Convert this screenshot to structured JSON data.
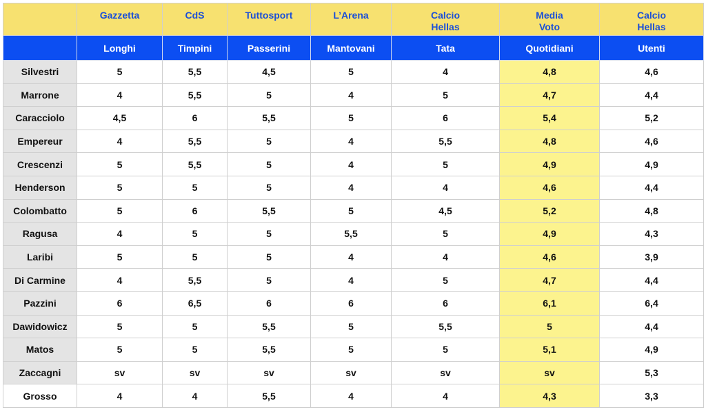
{
  "header_sources": [
    {
      "line1": "Gazzetta",
      "line2": ""
    },
    {
      "line1": "CdS",
      "line2": ""
    },
    {
      "line1": "Tuttosport",
      "line2": ""
    },
    {
      "line1": "L’Arena",
      "line2": ""
    },
    {
      "line1": "Calcio",
      "line2": "Hellas"
    },
    {
      "line1": "Media",
      "line2": "Voto"
    },
    {
      "line1": "Calcio",
      "line2": "Hellas"
    }
  ],
  "header_authors": [
    "Longhi",
    "Timpini",
    "Passerini",
    "Mantovani",
    "Tata",
    "Quotidiani",
    "Utenti"
  ],
  "rows": [
    {
      "player": "Silvestri",
      "ratings": [
        "5",
        "5,5",
        "4,5",
        "5",
        "4",
        "4,8",
        "4,6"
      ]
    },
    {
      "player": "Marrone",
      "ratings": [
        "4",
        "5,5",
        "5",
        "4",
        "5",
        "4,7",
        "4,4"
      ]
    },
    {
      "player": "Caracciolo",
      "ratings": [
        "4,5",
        "6",
        "5,5",
        "5",
        "6",
        "5,4",
        "5,2"
      ]
    },
    {
      "player": "Empereur",
      "ratings": [
        "4",
        "5,5",
        "5",
        "4",
        "5,5",
        "4,8",
        "4,6"
      ]
    },
    {
      "player": "Crescenzi",
      "ratings": [
        "5",
        "5,5",
        "5",
        "4",
        "5",
        "4,9",
        "4,9"
      ]
    },
    {
      "player": "Henderson",
      "ratings": [
        "5",
        "5",
        "5",
        "4",
        "4",
        "4,6",
        "4,4"
      ]
    },
    {
      "player": "Colombatto",
      "ratings": [
        "5",
        "6",
        "5,5",
        "5",
        "4,5",
        "5,2",
        "4,8"
      ]
    },
    {
      "player": "Ragusa",
      "ratings": [
        "4",
        "5",
        "5",
        "5,5",
        "5",
        "4,9",
        "4,3"
      ]
    },
    {
      "player": "Laribi",
      "ratings": [
        "5",
        "5",
        "5",
        "4",
        "4",
        "4,6",
        "3,9"
      ]
    },
    {
      "player": "Di Carmine",
      "ratings": [
        "4",
        "5,5",
        "5",
        "4",
        "5",
        "4,7",
        "4,4"
      ]
    },
    {
      "player": "Pazzini",
      "ratings": [
        "6",
        "6,5",
        "6",
        "6",
        "6",
        "6,1",
        "6,4"
      ]
    },
    {
      "player": "Dawidowicz",
      "ratings": [
        "5",
        "5",
        "5,5",
        "5",
        "5,5",
        "5",
        "4,4"
      ]
    },
    {
      "player": "Matos",
      "ratings": [
        "5",
        "5",
        "5,5",
        "5",
        "5",
        "5,1",
        "4,9"
      ]
    },
    {
      "player": "Zaccagni",
      "ratings": [
        "sv",
        "sv",
        "sv",
        "sv",
        "sv",
        "sv",
        "5,3"
      ]
    },
    {
      "player": "Grosso",
      "ratings": [
        "4",
        "4",
        "5,5",
        "4",
        "4",
        "4,3",
        "3,3"
      ]
    }
  ],
  "colors": {
    "header_bg": "#f7e170",
    "header_text": "#1b4fd8",
    "subheader_bg": "#0c4ef2",
    "subheader_text": "#ffffff",
    "player_cell_bg": "#e4e4e4",
    "average_column_bg": "#fcf38e"
  }
}
